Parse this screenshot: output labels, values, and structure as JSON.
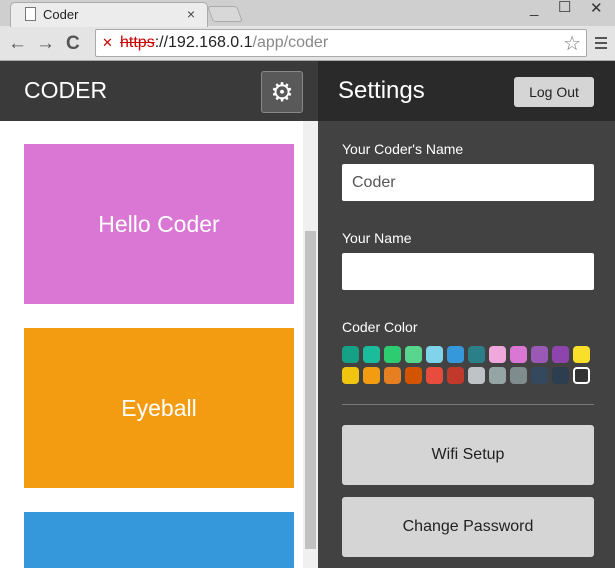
{
  "browser": {
    "tab_title": "Coder",
    "tab_close": "×",
    "url_scheme": "https",
    "url_host": "://192.168.0.1",
    "url_path": "/app/coder",
    "back": "←",
    "forward": "→",
    "reload": "C",
    "minimize": "_",
    "maximize": "☐",
    "close": "✕",
    "star": "☆"
  },
  "left": {
    "title": "CODER",
    "gear": "⚙",
    "cards": [
      {
        "label": "Hello Coder",
        "color": "#da77d4"
      },
      {
        "label": "Eyeball",
        "color": "#f39c12"
      },
      {
        "label": "",
        "color": "#3498db"
      }
    ]
  },
  "right": {
    "title": "Settings",
    "logout": "Log Out",
    "coder_name_label": "Your Coder's Name",
    "coder_name_value": "Coder",
    "your_name_label": "Your Name",
    "your_name_value": "",
    "color_label": "Coder Color",
    "colors": [
      "#16a085",
      "#1abc9c",
      "#2ecc71",
      "#58d68d",
      "#7fd3ea",
      "#3498db",
      "#2a7f88",
      "#f0a8dc",
      "#da77d4",
      "#9b59b6",
      "#8e44ad",
      "#f9df2a",
      "#f1c40f",
      "#f39c12",
      "#e67e22",
      "#d35400",
      "#e74c3c",
      "#c0392b",
      "#bdc3c7",
      "#95a5a6",
      "#7f8c8d",
      "#34495e",
      "#2c3e50",
      "#333333"
    ],
    "selected_color": "#333333",
    "wifi": "Wifi Setup",
    "password": "Change Password"
  }
}
